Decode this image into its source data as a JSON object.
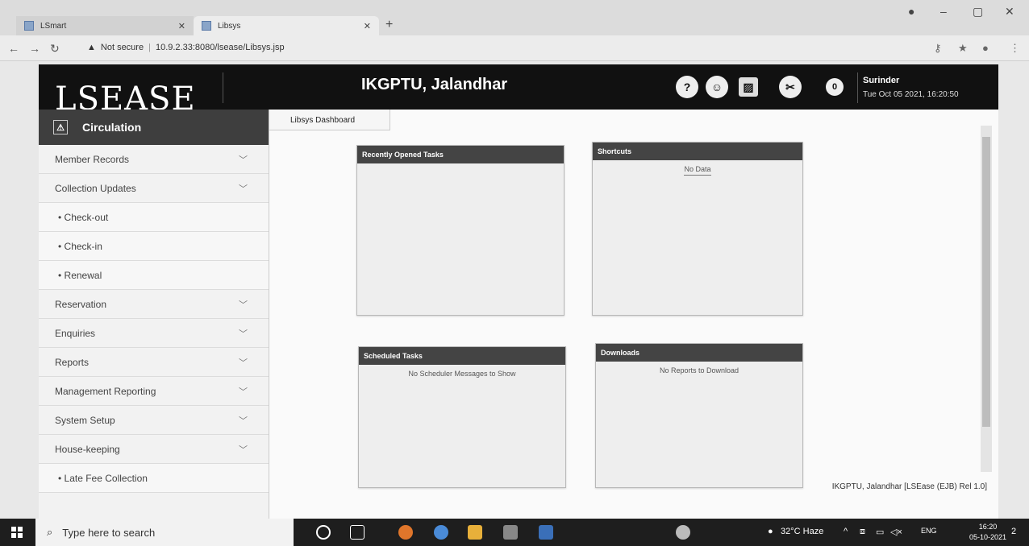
{
  "browser": {
    "tabs": [
      {
        "label": "LSmart"
      },
      {
        "label": "Libsys"
      }
    ],
    "address": {
      "security": "Not secure",
      "url": "10.9.2.33:8080/lsease/Libsys.jsp"
    }
  },
  "header": {
    "logo": "LSEASE",
    "title": "IKGPTU, Jalandhar",
    "icons": [
      "help-icon",
      "people-icon",
      "image-icon",
      "tools-icon"
    ],
    "badge_count": "0",
    "user_name": "Surinder",
    "datetime": "Tue Oct 05 2021, 16:20:50"
  },
  "sidebar": {
    "section": "Circulation",
    "items": [
      {
        "label": "Member Records",
        "type": "group"
      },
      {
        "label": "Collection Updates",
        "type": "group"
      },
      {
        "label": "• Check-out",
        "type": "sub"
      },
      {
        "label": "• Check-in",
        "type": "sub"
      },
      {
        "label": "• Renewal",
        "type": "sub"
      },
      {
        "label": "Reservation",
        "type": "group"
      },
      {
        "label": "Enquiries",
        "type": "group"
      },
      {
        "label": "Reports",
        "type": "group"
      },
      {
        "label": "Management Reporting",
        "type": "group"
      },
      {
        "label": "System Setup",
        "type": "group"
      },
      {
        "label": "House-keeping",
        "type": "group"
      },
      {
        "label": "• Late Fee Collection",
        "type": "sub"
      }
    ]
  },
  "main": {
    "tab": "Libsys Dashboard",
    "panels": {
      "recent": {
        "title": "Recently Opened Tasks",
        "message": ""
      },
      "shortcuts": {
        "title": "Shortcuts",
        "message": "No Data"
      },
      "scheduled": {
        "title": "Scheduled Tasks",
        "message": "No Scheduler Messages to Show"
      },
      "downloads": {
        "title": "Downloads",
        "message": "No Reports to Download"
      }
    },
    "footer": "IKGPTU, Jalandhar [LSEase (EJB) Rel 1.0]"
  },
  "taskbar": {
    "search_placeholder": "Type here to search",
    "weather": "32°C Haze",
    "lang": "ENG",
    "time": "16:20",
    "date": "05-10-2021",
    "notifications": "2"
  },
  "colors": {
    "header_bg": "#111111",
    "sidebar_head": "#3e3e3e",
    "panel_head": "#444444"
  }
}
